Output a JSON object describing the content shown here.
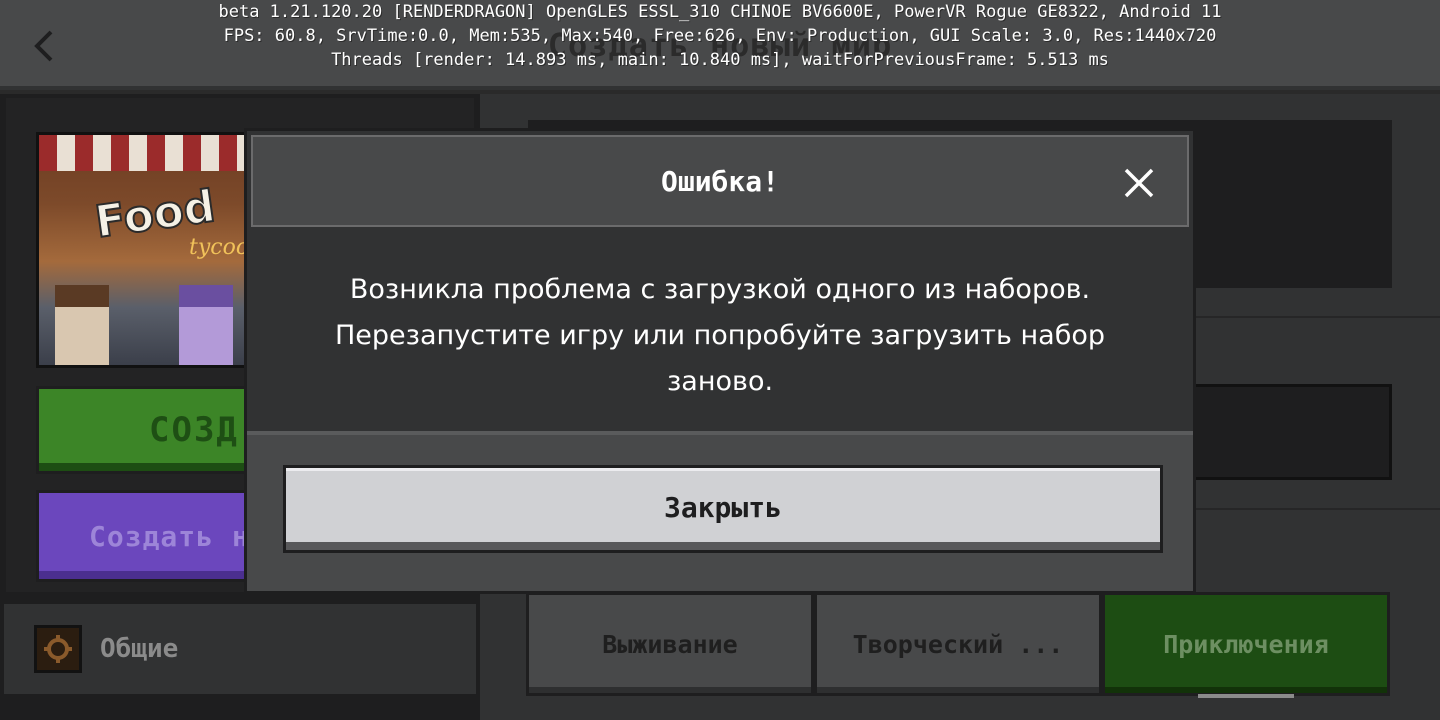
{
  "debug": {
    "line1": "beta 1.21.120.20 [RENDERDRAGON] OpenGLES ESSL_310 CHINOE BV6600E, PowerVR Rogue GE8322, Android 11",
    "line2": "FPS: 60.8, SrvTime:0.0, Mem:535, Max:540, Free:626, Env: Production, GUI Scale: 3.0, Res:1440x720",
    "line3": "Threads [render: 14.893 ms, main: 10.840 ms], waitForPreviousFrame: 5.513 ms"
  },
  "header": {
    "title": "Создать новый мир",
    "back_icon": "chevron-left-icon"
  },
  "left": {
    "template_logo": "Food",
    "template_logo_sub": "tycoon",
    "create_label": "СОЗД",
    "realm_label": "Создать н",
    "general_label": "Общие",
    "general_icon": "gear-icon"
  },
  "modes": [
    {
      "label": "Выживание"
    },
    {
      "label": "Творческий ..."
    },
    {
      "label": "Приключения"
    }
  ],
  "dialog": {
    "title": "Ошибка!",
    "message_line1": "Возникла проблема с загрузкой одного из наборов.",
    "message_line2": "Перезапустите игру или попробуйте загрузить набор",
    "message_line3": "заново.",
    "close_button_label": "Закрыть",
    "close_icon": "close-icon"
  },
  "colors": {
    "panel": "#313233",
    "header": "#48494a",
    "button_light": "#d0d1d4",
    "create_green": "#3c8527",
    "realm_purple": "#6b47bd"
  }
}
